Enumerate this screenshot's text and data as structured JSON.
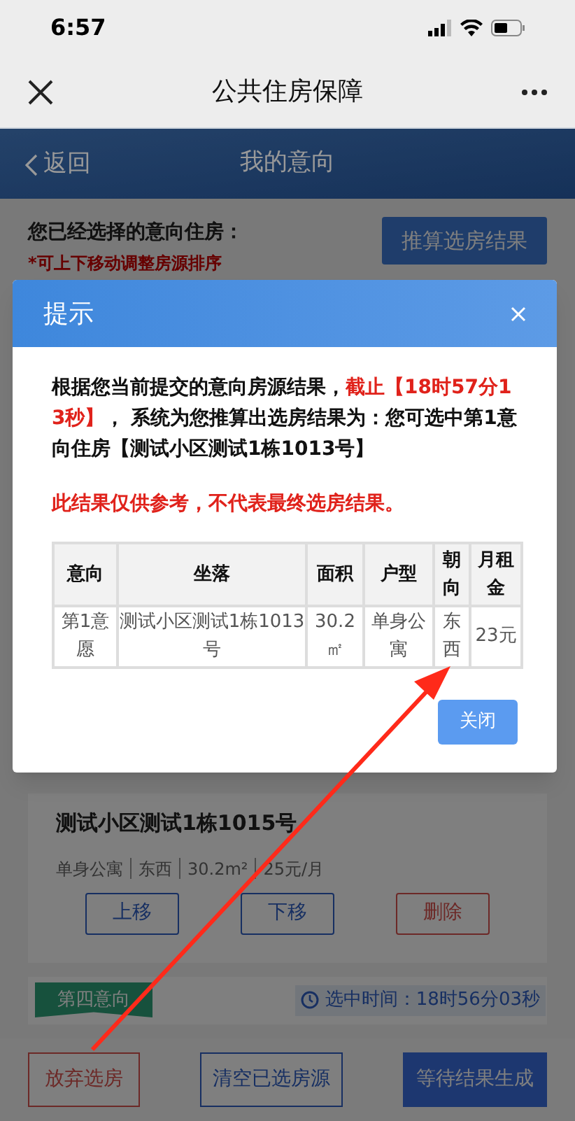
{
  "status_bar": {
    "time": "6:57"
  },
  "nav_bar": {
    "title": "公共住房保障"
  },
  "header": {
    "back": "返回",
    "title": "我的意向"
  },
  "intro": {
    "heading": "您已经选择的意向住房：",
    "hint": "*可上下移动调整房源排序",
    "action": "推算选房结果"
  },
  "card": {
    "title": "测试小区测试1栋1015号",
    "details": [
      "单身公寓",
      "东西",
      "30.2m²",
      "25元/月"
    ],
    "buttons": [
      {
        "label": "上移",
        "kind": "normal"
      },
      {
        "label": "下移",
        "kind": "normal"
      },
      {
        "label": "删除",
        "kind": "danger"
      }
    ]
  },
  "next_card": {
    "ribbon": "第四意向",
    "selected_time": "选中时间：18时56分03秒"
  },
  "footer_buttons": [
    {
      "label": "放弃选房",
      "kind": "danger"
    },
    {
      "label": "清空已选房源",
      "kind": "outline"
    },
    {
      "label": "等待结果生成",
      "kind": "primary"
    }
  ],
  "dialog": {
    "title": "提示",
    "message": [
      {
        "text": "根据您当前提交的意向房源结果，",
        "kind": "normal"
      },
      {
        "text": "截止【18时57分13秒】",
        "kind": "highlight"
      },
      {
        "text": "，  系统为您推算出选房结果为：您可选中第1意向住房【测试小区测试1栋1013号】",
        "kind": "normal"
      }
    ],
    "notice": "此结果仅供参考，不代表最终选房结果。",
    "table": {
      "columns": [
        "意向",
        "坐落",
        "面积",
        "户型",
        "朝向",
        "月租金"
      ],
      "rows": [
        [
          "第1意愿",
          "测试小区测试1栋1013号",
          "30.2㎡",
          "单身公寓",
          "东西",
          "23元"
        ]
      ]
    },
    "button": "关闭"
  }
}
